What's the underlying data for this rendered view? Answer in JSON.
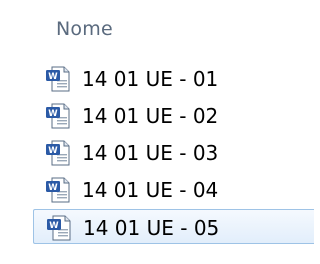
{
  "header": {
    "column_name_label": "Nome"
  },
  "icons": {
    "file_icon": "word-document-icon"
  },
  "colors": {
    "header_text": "#5a6a7e",
    "selection_border": "#9ec3e6",
    "selection_fill": "#e2eefb",
    "word_icon_blue": "#2b5aa6"
  },
  "files": [
    {
      "name": "14 01 UE - 01",
      "selected": false
    },
    {
      "name": "14 01 UE - 02",
      "selected": false
    },
    {
      "name": "14 01 UE - 03",
      "selected": false
    },
    {
      "name": "14 01 UE - 04",
      "selected": false
    },
    {
      "name": "14 01 UE - 05",
      "selected": true
    }
  ]
}
